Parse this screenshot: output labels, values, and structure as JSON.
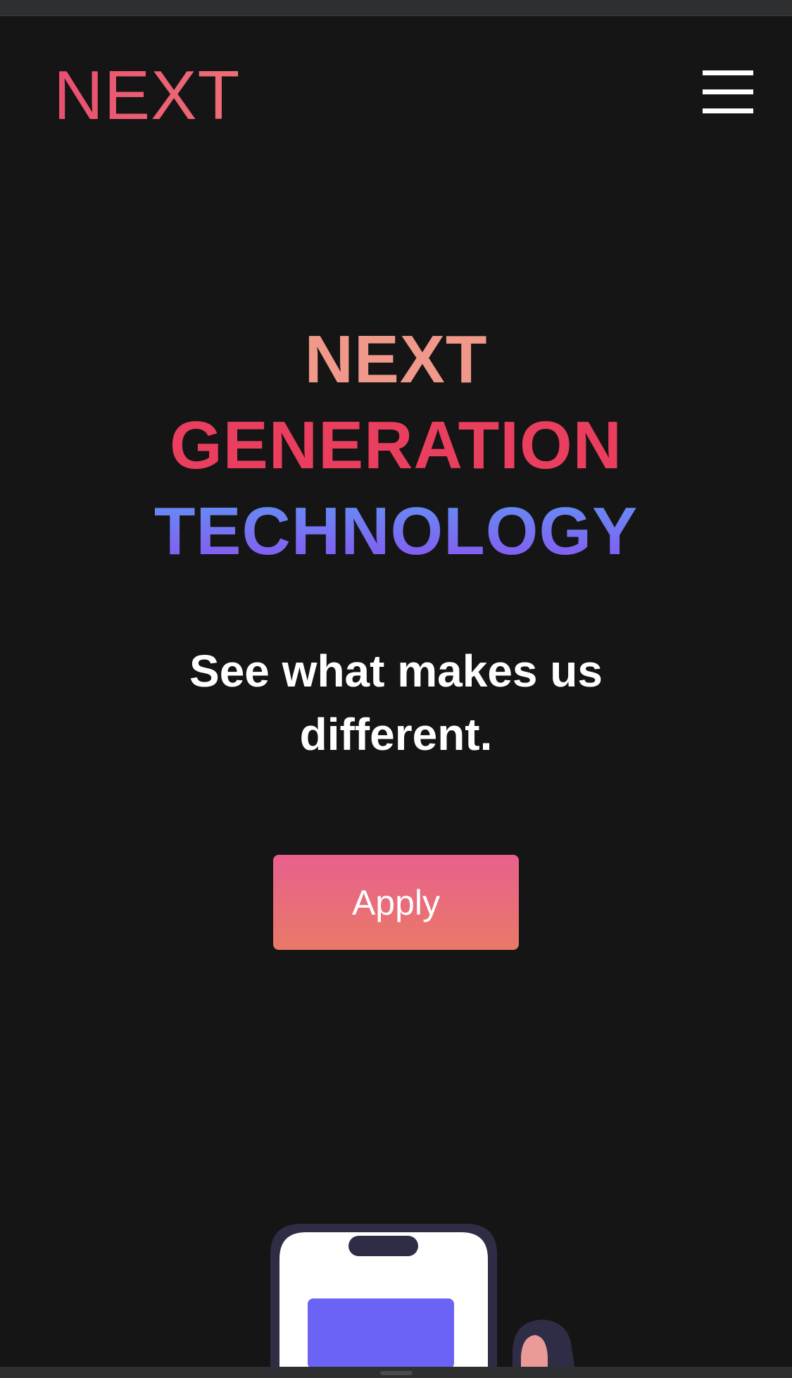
{
  "header": {
    "logo_text": "NEXT",
    "menu_icon": "hamburger-menu-icon"
  },
  "hero": {
    "line_1": "NEXT",
    "line_2": "GENERATION",
    "line_3": "TECHNOLOGY",
    "tagline": "See what makes us different.",
    "apply_label": "Apply"
  },
  "colors": {
    "background": "#151515",
    "logo": "#e94f6f",
    "hero_line_1": "#f0998a",
    "hero_line_2": "#ea3e5f",
    "hero_line_3_start": "#5f98f4",
    "hero_line_3_end": "#8b4ff0",
    "button_top": "#e8608e",
    "button_bottom": "#e97967",
    "phone_screen_card": "#6b63f5"
  },
  "illustration": {
    "name": "phone-with-person-illustration"
  }
}
